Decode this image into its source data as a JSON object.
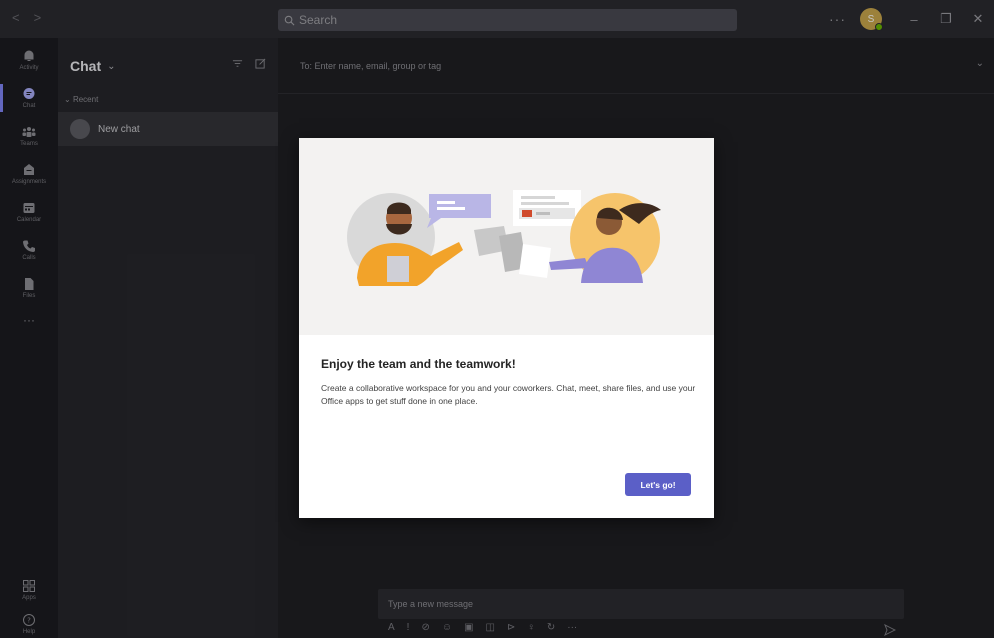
{
  "titlebar": {
    "back_icon": "chevron-left-icon",
    "forward_icon": "chevron-right-icon",
    "search_placeholder": "Search",
    "more": "···",
    "avatar_initial": "S",
    "presence_color": "#6bb700",
    "minimize": "–",
    "restore": "❐",
    "close": "✕"
  },
  "rail": {
    "items": [
      {
        "label": "Activity",
        "icon": "bell-icon"
      },
      {
        "label": "Chat",
        "icon": "chat-icon",
        "active": true
      },
      {
        "label": "Teams",
        "icon": "teams-icon"
      },
      {
        "label": "Assignments",
        "icon": "assignments-icon"
      },
      {
        "label": "Calendar",
        "icon": "calendar-icon"
      },
      {
        "label": "Calls",
        "icon": "phone-icon"
      },
      {
        "label": "Files",
        "icon": "file-icon"
      }
    ],
    "more": "···",
    "bottom": [
      {
        "label": "Apps",
        "icon": "apps-icon"
      },
      {
        "label": "Help",
        "icon": "help-icon"
      }
    ]
  },
  "chat_list": {
    "title": "Chat",
    "section": "Recent",
    "items": [
      {
        "label": "New chat"
      }
    ]
  },
  "main": {
    "to_label": "To:  Enter name, email, group or tag",
    "composer_placeholder": "Type a new message",
    "composer_icons": [
      "format-icon",
      "important-icon",
      "attach-icon",
      "emoji-icon",
      "gif-icon",
      "sticker-icon",
      "meet-icon",
      "praise-icon",
      "loop-icon",
      "more-icon"
    ]
  },
  "modal": {
    "title": "Enjoy the team and the teamwork!",
    "body": "Create a collaborative workspace for you and your coworkers. Chat, meet, share files, and use your Office apps to get stuff done in one place.",
    "cta": "Let's go!"
  },
  "colors": {
    "accent": "#5b5fc7",
    "rail_active": "#7f85f5",
    "hero_bg": "#f3f2f1"
  }
}
